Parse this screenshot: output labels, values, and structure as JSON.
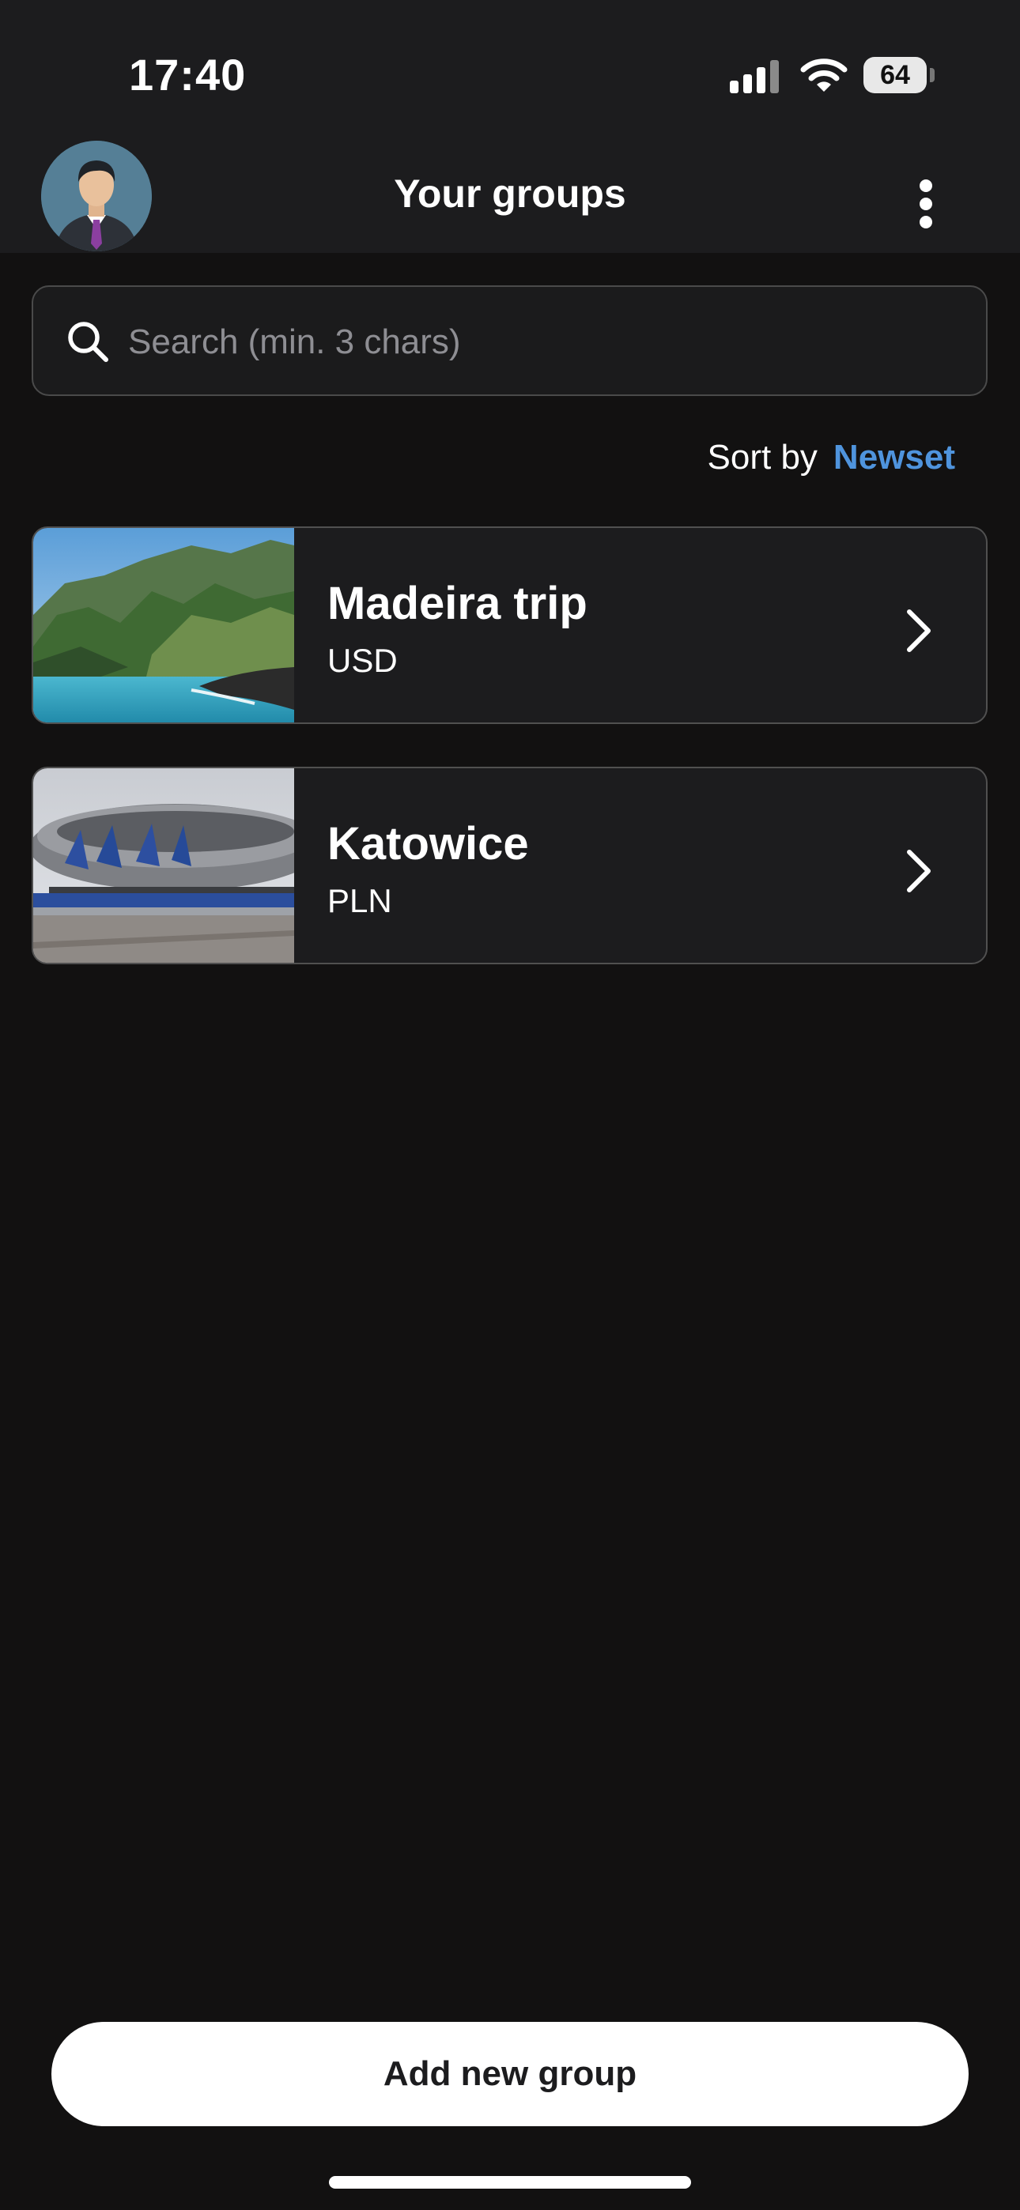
{
  "status_bar": {
    "time": "17:40",
    "battery": "64",
    "icons": [
      "cellular-signal-icon",
      "wifi-icon",
      "battery-icon"
    ]
  },
  "header": {
    "title": "Your groups",
    "avatar_icon": "user-avatar",
    "menu_icon": "more-vertical-icon"
  },
  "search": {
    "placeholder": "Search (min. 3 chars)",
    "value": "",
    "icon": "search-icon"
  },
  "sort": {
    "label": "Sort by",
    "value": "Newset"
  },
  "groups": [
    {
      "name": "Madeira trip",
      "currency": "USD",
      "image": "coastal-mountains-photo"
    },
    {
      "name": "Katowice",
      "currency": "PLN",
      "image": "arena-building-photo"
    }
  ],
  "actions": {
    "add_group_label": "Add new group"
  },
  "colors": {
    "background": "#121111",
    "surface": "#1c1c1e",
    "accent": "#4f94dd",
    "primary_button": "#ffffff"
  }
}
